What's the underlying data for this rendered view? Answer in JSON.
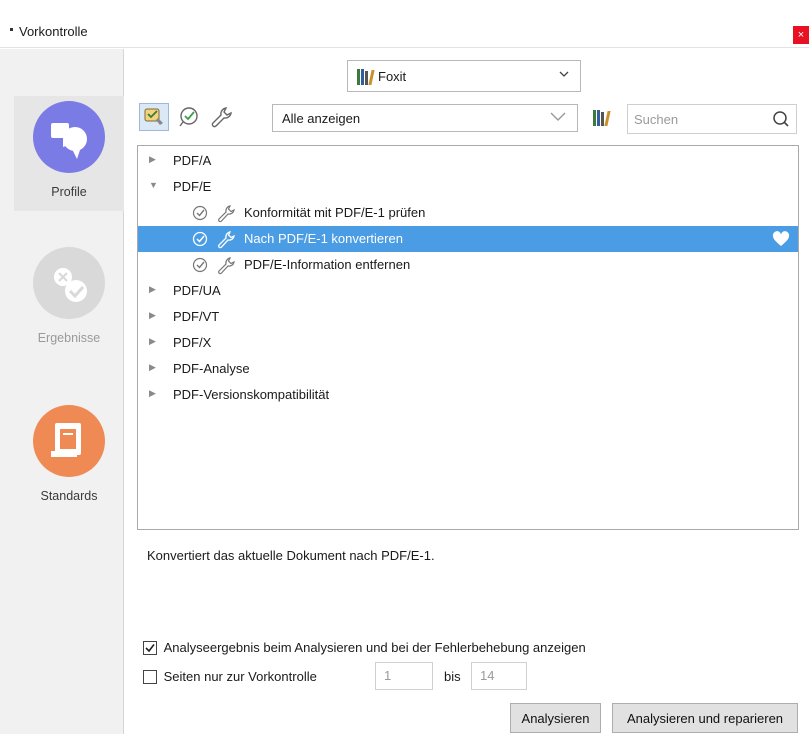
{
  "window": {
    "title": "Vorkontrolle",
    "close_glyph": "×"
  },
  "sidebar": {
    "items": [
      {
        "label": "Profile",
        "icon": "profile-bubbles-icon",
        "color": "#7b7be6",
        "state": "selected"
      },
      {
        "label": "Ergebnisse",
        "icon": "results-check-icon",
        "color": "#d9d9d9",
        "state": "disabled"
      },
      {
        "label": "Standards",
        "icon": "standards-book-icon",
        "color": "#f08a54",
        "state": "normal"
      }
    ]
  },
  "profile_selector": {
    "value": "Foxit",
    "icon": "library-books-icon"
  },
  "toolbar": {
    "buttons": [
      {
        "name": "profiles-view-icon",
        "active": true
      },
      {
        "name": "check-icon",
        "active": false
      },
      {
        "name": "wrench-icon",
        "active": false
      }
    ],
    "filter": {
      "value": "Alle anzeigen"
    },
    "library_icon": "library-books-icon",
    "search": {
      "placeholder": "Suchen"
    }
  },
  "tree": {
    "items": [
      {
        "label": "PDF/A",
        "level": 0,
        "expanded": false
      },
      {
        "label": "PDF/E",
        "level": 0,
        "expanded": true
      },
      {
        "label": "Konformität mit PDF/E-1 prüfen",
        "level": 1
      },
      {
        "label": "Nach PDF/E-1 konvertieren",
        "level": 1,
        "selected": true,
        "favorite": true
      },
      {
        "label": "PDF/E-Information entfernen",
        "level": 1
      },
      {
        "label": "PDF/UA",
        "level": 0,
        "expanded": false
      },
      {
        "label": "PDF/VT",
        "level": 0,
        "expanded": false
      },
      {
        "label": "PDF/X",
        "level": 0,
        "expanded": false
      },
      {
        "label": "PDF-Analyse",
        "level": 0,
        "expanded": false
      },
      {
        "label": "PDF-Versionskompatibilität",
        "level": 0,
        "expanded": false
      }
    ]
  },
  "description": "Konvertiert das aktuelle Dokument nach PDF/E-1.",
  "options": {
    "show_result": {
      "label": "Analyseergebnis beim Analysieren und bei der Fehlerbehebung anzeigen",
      "checked": true
    },
    "pages_only": {
      "label": "Seiten nur zur Vorkontrolle",
      "checked": false
    },
    "from_page": "1",
    "to_label": "bis",
    "to_page": "14"
  },
  "buttons": {
    "analyze": "Analysieren",
    "analyze_repair": "Analysieren und reparieren"
  },
  "colors": {
    "selection": "#4a9de4",
    "close": "#e81123"
  }
}
